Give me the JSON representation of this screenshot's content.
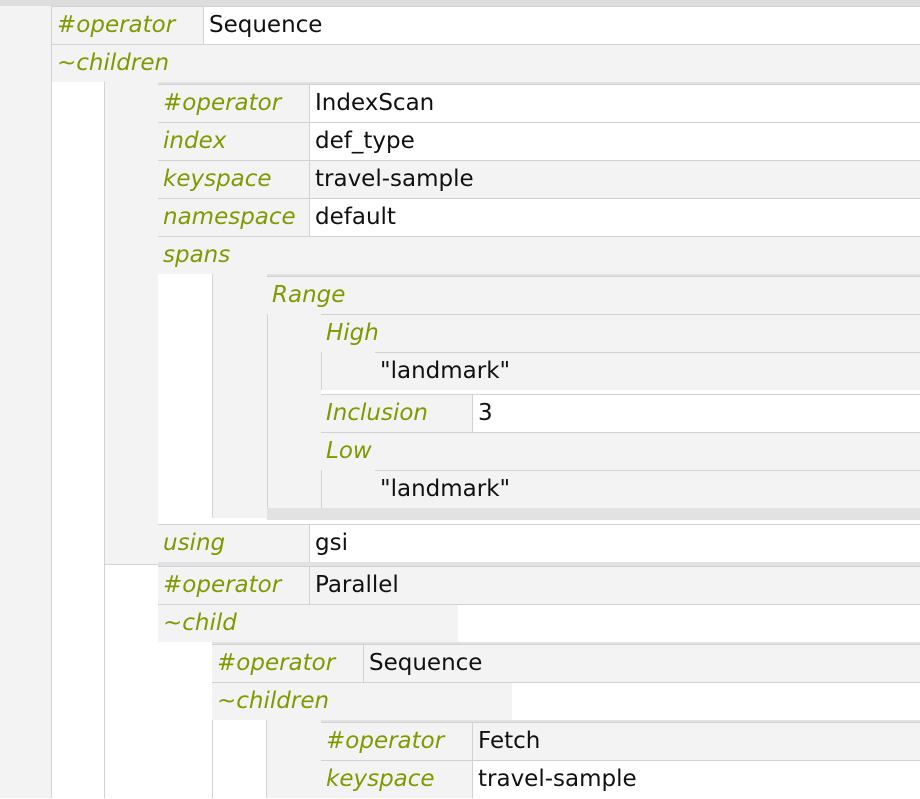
{
  "plan": {
    "root_operator": {
      "key": "#operator",
      "value": "Sequence"
    },
    "root_children_key": "~children",
    "index_scan": {
      "operator": {
        "key": "#operator",
        "value": "IndexScan"
      },
      "index": {
        "key": "index",
        "value": "def_type"
      },
      "keyspace": {
        "key": "keyspace",
        "value": "travel-sample"
      },
      "namespace": {
        "key": "namespace",
        "value": "default"
      },
      "spans_key": "spans",
      "range": {
        "key": "Range",
        "high_key": "High",
        "high_value": "\"landmark\"",
        "inclusion": {
          "key": "Inclusion",
          "value": "3"
        },
        "low_key": "Low",
        "low_value": "\"landmark\""
      },
      "using": {
        "key": "using",
        "value": "gsi"
      }
    },
    "parallel": {
      "operator": {
        "key": "#operator",
        "value": "Parallel"
      },
      "child_key": "~child",
      "sequence": {
        "operator": {
          "key": "#operator",
          "value": "Sequence"
        },
        "children_key": "~children",
        "fetch": {
          "operator": {
            "key": "#operator",
            "value": "Fetch"
          },
          "keyspace": {
            "key": "keyspace",
            "value": "travel-sample"
          }
        }
      }
    }
  }
}
